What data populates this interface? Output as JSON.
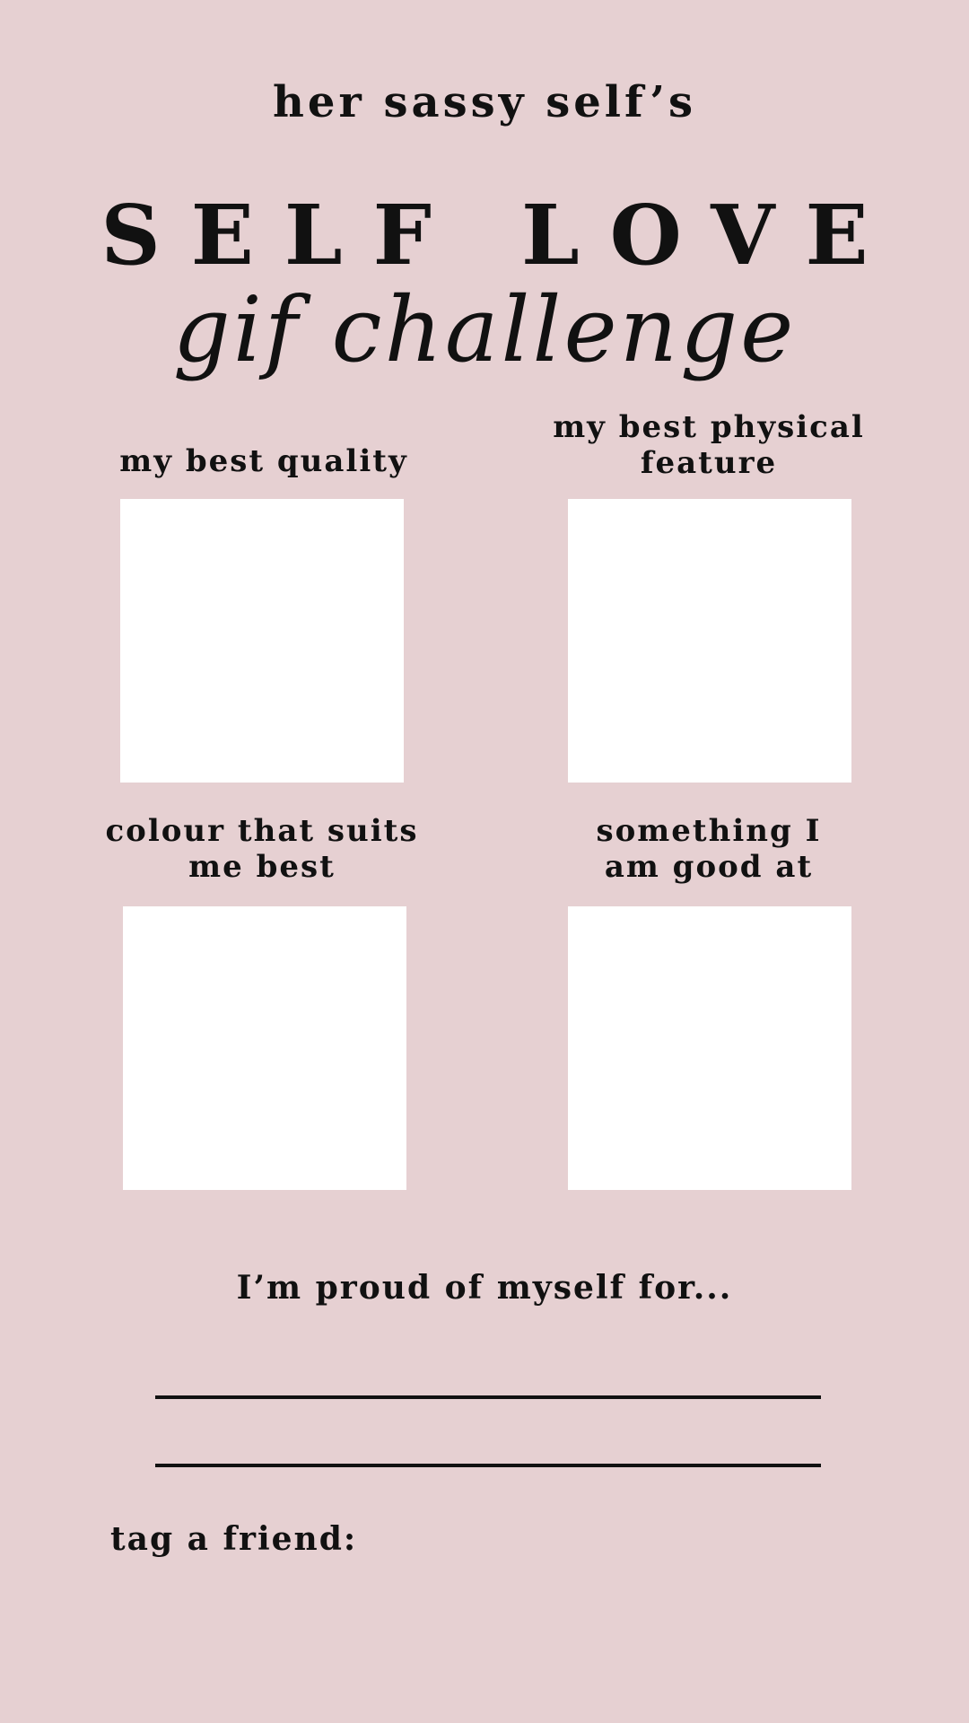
{
  "colors": {
    "background": "#e6d0d2",
    "text": "#111111",
    "box": "#ffffff"
  },
  "brand": "her sassy self’s",
  "title": "SELF LOVE",
  "subtitle": "gif challenge",
  "prompts": [
    {
      "label": "my best quality"
    },
    {
      "label_line1": "my best physical",
      "label_line2": "feature"
    },
    {
      "label_line1": "colour that suits",
      "label_line2": "me best"
    },
    {
      "label_line1": "something I",
      "label_line2": "am good at"
    }
  ],
  "proud_prompt": "I’m proud of myself for...",
  "tag_label": "tag a friend:"
}
